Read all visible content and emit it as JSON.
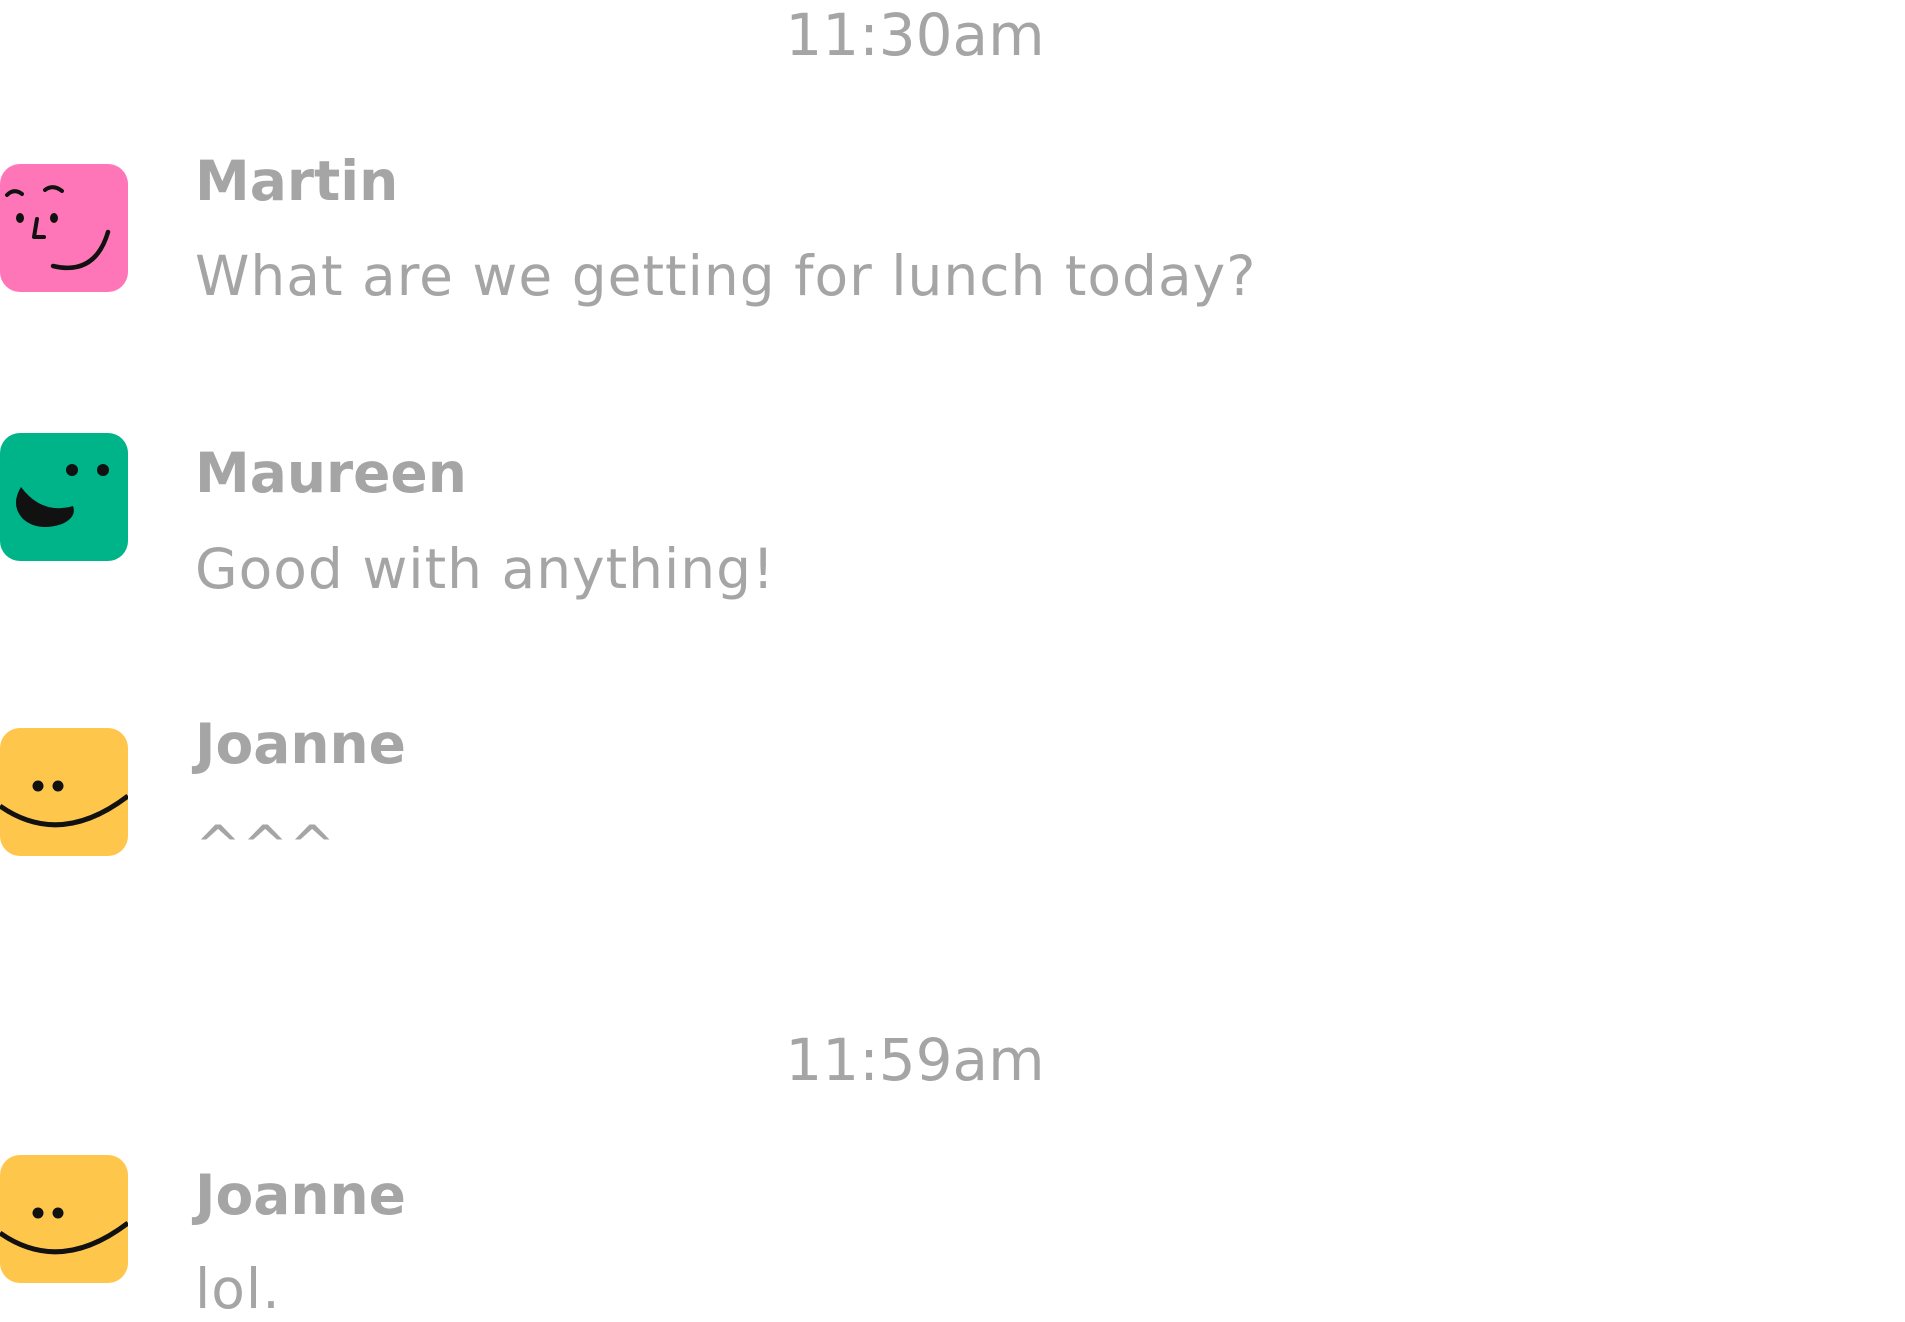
{
  "timestamps": [
    "11:30am",
    "11:59am"
  ],
  "messages": [
    {
      "author": "Martin",
      "text": "What are we getting for lunch today?",
      "avatar": {
        "icon": "wink-face-icon",
        "color": "#ff76b8"
      }
    },
    {
      "author": "Maureen",
      "text": "Good with anything!",
      "avatar": {
        "icon": "laughing-face-icon",
        "color": "#00b489"
      }
    },
    {
      "author": "Joanne",
      "text": "^^^",
      "avatar": {
        "icon": "smiling-face-icon",
        "color": "#ffc64c"
      }
    },
    {
      "author": "Joanne",
      "text": "lol.",
      "avatar": {
        "icon": "smiling-face-icon",
        "color": "#ffc64c"
      }
    }
  ]
}
